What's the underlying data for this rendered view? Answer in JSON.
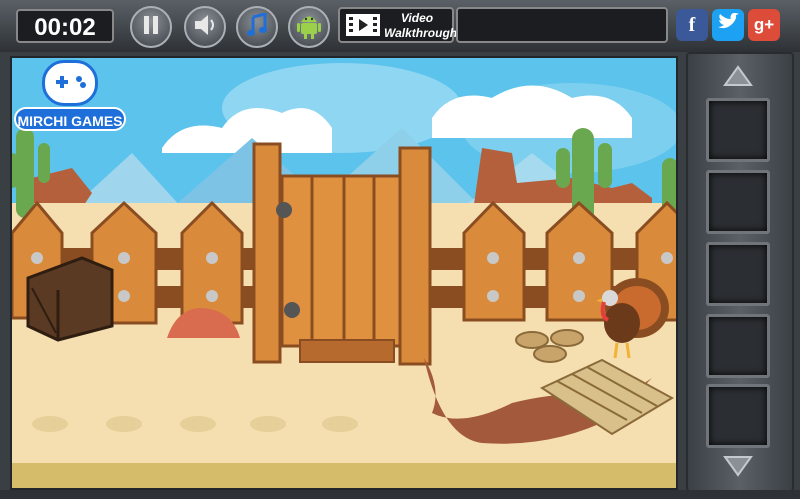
{
  "hud": {
    "timer": "00:02",
    "video_label_line1": "Video",
    "video_label_line2": "Walkthrough",
    "pause_icon": "pause-icon",
    "sound_icon": "speaker-icon",
    "music_icon": "music-note-icon",
    "android_icon": "android-icon"
  },
  "social": {
    "facebook": "f",
    "google_plus": "g+"
  },
  "logo": {
    "line1": "MIRCHI GAMES"
  },
  "colors": {
    "sky": "#5cc3ec",
    "sand": "#f5dfb0",
    "wood": "#d98a3a",
    "facebook": "#3b5998",
    "twitter": "#1da1f2",
    "google_plus": "#dd4b39"
  },
  "inventory": {
    "slots": 5
  }
}
